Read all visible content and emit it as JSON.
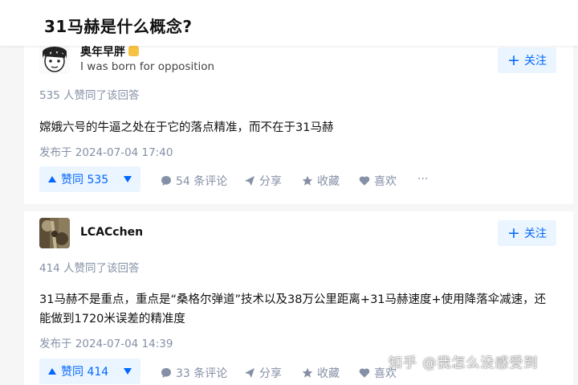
{
  "question": {
    "title": "31马赫是什么概念?"
  },
  "answers": [
    {
      "author_name": "奥年早胖",
      "author_bio": "I was born for opposition",
      "follow_label": "关注",
      "vote_count_text": "535 人赞同了该回答",
      "content": "嫦娥六号的牛逼之处在于它的落点精准，而不在于31马赫",
      "published": "发布于 2024-07-04 17:40",
      "vote_label": "赞同 535",
      "comments_label": "54 条评论",
      "share_label": "分享",
      "collect_label": "收藏",
      "like_label": "喜欢",
      "more_label": "···"
    },
    {
      "author_name": "LCACchen",
      "author_bio": "",
      "follow_label": "关注",
      "vote_count_text": "414 人赞同了该回答",
      "content": "31马赫不是重点，重点是“桑格尔弹道”技术以及38万公里距离+31马赫速度+使用降落伞减速，还能做到1720米误差的精准度",
      "published": "发布于 2024-07-04 14:39",
      "vote_label": "赞同 414",
      "comments_label": "33 条评论",
      "share_label": "分享",
      "collect_label": "收藏",
      "like_label": "喜欢",
      "more_label": "···"
    }
  ],
  "watermark": "知乎 @我怎么没感受到",
  "colors": {
    "accent": "#0066ff",
    "accent_bg": "#ebf5ff",
    "meta_text": "#8590a6",
    "background": "#f6f6f6"
  }
}
